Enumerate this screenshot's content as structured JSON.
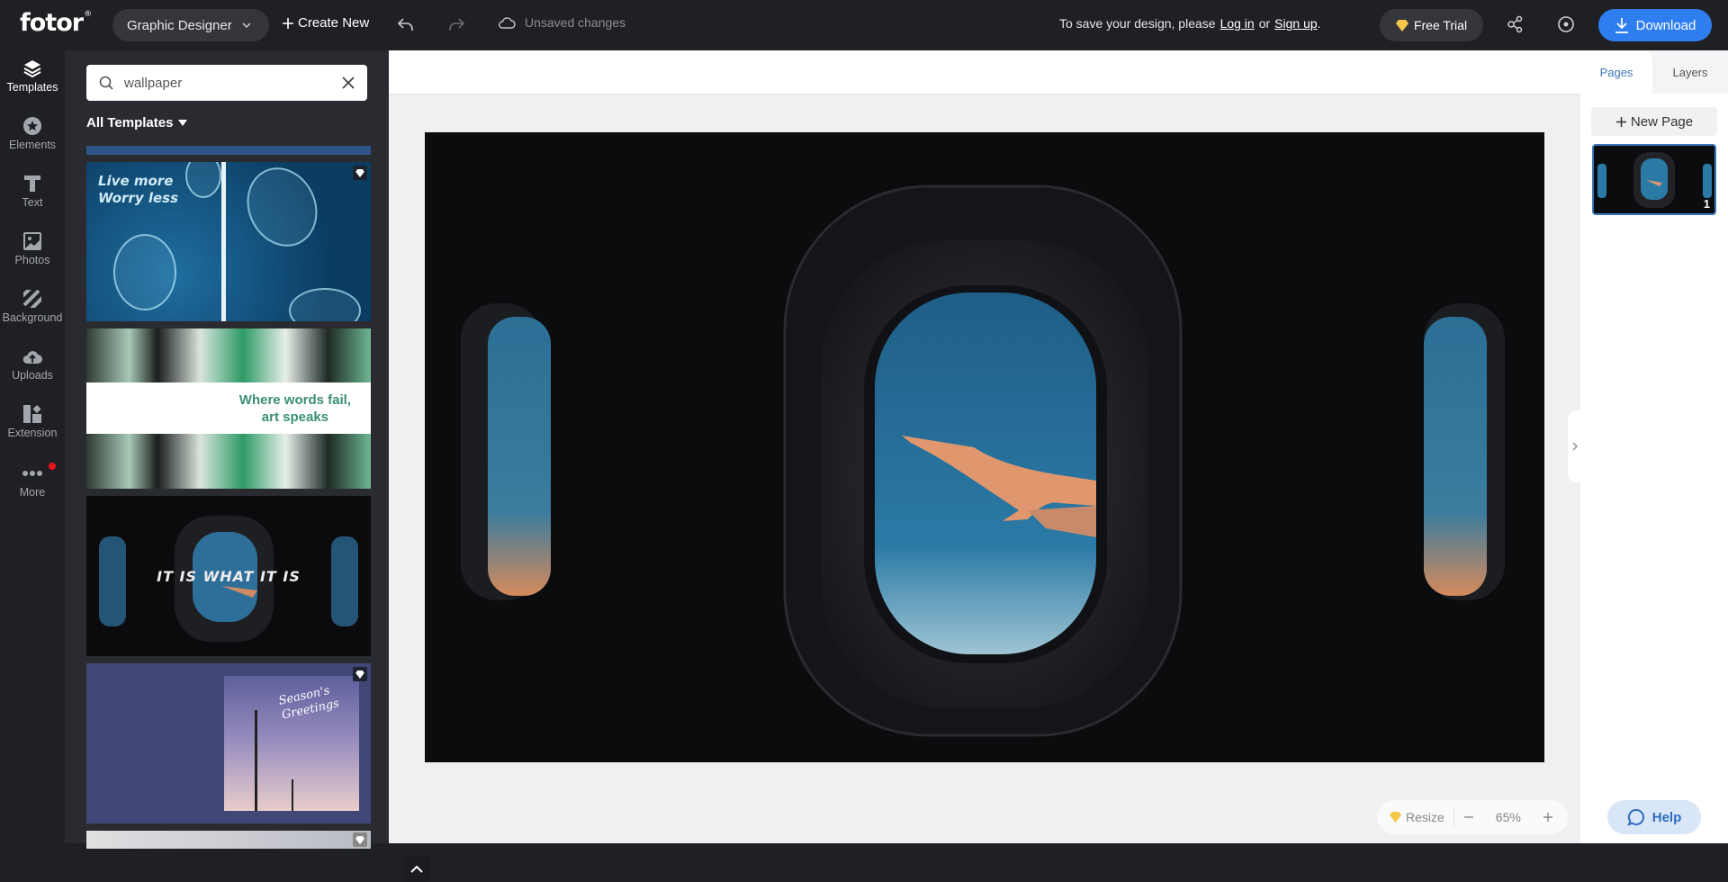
{
  "header": {
    "logo": "fotor",
    "logo_mark": "®",
    "role_selector": "Graphic Designer",
    "create_new": "Create New",
    "unsaved_status": "Unsaved changes",
    "save_prompt_prefix": "To save your design, please",
    "login_link": "Log in",
    "or_text": "or",
    "signup_link": "Sign up",
    "save_prompt_suffix": ".",
    "free_trial": "Free Trial",
    "download": "Download"
  },
  "sidebar": {
    "items": [
      {
        "label": "Templates",
        "icon": "layers-icon",
        "active": true
      },
      {
        "label": "Elements",
        "icon": "star-icon"
      },
      {
        "label": "Text",
        "icon": "text-icon"
      },
      {
        "label": "Photos",
        "icon": "photo-icon"
      },
      {
        "label": "Background",
        "icon": "background-icon"
      },
      {
        "label": "Uploads",
        "icon": "upload-cloud-icon"
      },
      {
        "label": "Extension",
        "icon": "extension-icon"
      },
      {
        "label": "More",
        "icon": "more-icon",
        "badge": true
      }
    ]
  },
  "templates_panel": {
    "search_value": "wallpaper",
    "filter_label": "All Templates",
    "templates": [
      {
        "text": "Live more\nWorry less",
        "premium": true
      },
      {
        "text": "Where words fail,\nart speaks",
        "premium": false
      },
      {
        "text": "IT IS WHAT IT IS",
        "premium": false
      },
      {
        "text": "Season's\nGreetings",
        "premium": true
      },
      {
        "text": "",
        "premium": true
      }
    ]
  },
  "canvas": {
    "zoom_level": "65%",
    "resize_label": "Resize"
  },
  "right_panel": {
    "tabs": [
      "Pages",
      "Layers"
    ],
    "active_tab": "Pages",
    "new_page": "New Page",
    "pages": [
      {
        "number": "1"
      }
    ]
  },
  "help": {
    "label": "Help"
  },
  "colors": {
    "accent": "#2f7ef0",
    "topbar_bg": "#1f2024",
    "panel_bg": "#2a2b30",
    "premium_gold": "#f5c84a",
    "notification_red": "#e8141c"
  }
}
